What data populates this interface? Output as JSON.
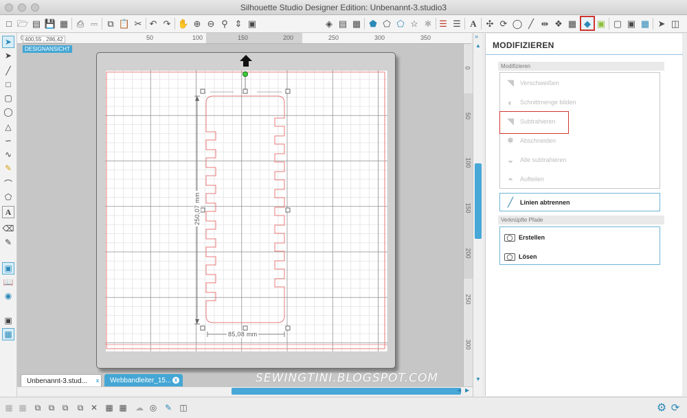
{
  "window": {
    "title": "Silhouette Studio Designer Edition: Unbenannt-3.studio3"
  },
  "canvas": {
    "coords": "400,55 , 286,42",
    "view_tag": "DESIGNANSICHT",
    "ruler_top": [
      "0",
      "50",
      "100",
      "150",
      "200",
      "250",
      "300",
      "350"
    ],
    "ruler_right": [
      "0",
      "50",
      "100",
      "150",
      "200",
      "250",
      "300"
    ],
    "height_label": "250,07 mm",
    "width_label": "85,08 mm",
    "watermark": "SEWINGTINI.BLOGSPOT.COM"
  },
  "tabs": [
    {
      "label": "Unbenannt-3.stud...",
      "active": true
    },
    {
      "label": "Webbandleiter_15...",
      "active": false
    }
  ],
  "panel": {
    "title": "MODIFIZIEREN",
    "section_modify": "Modifizieren",
    "modify_options": [
      {
        "label": "Verschweißen",
        "enabled": false
      },
      {
        "label": "Schnittmenge bilden",
        "enabled": false
      },
      {
        "label": "Subtrahieren",
        "enabled": false
      },
      {
        "label": "Abschneiden",
        "enabled": false
      },
      {
        "label": "Alle subtrahieren",
        "enabled": false
      },
      {
        "label": "Aufteilen",
        "enabled": false
      }
    ],
    "lines_button": "Linien abtrennen",
    "section_paths": "Verknüpfte Pfade",
    "path_options": [
      {
        "label": "Erstellen"
      },
      {
        "label": "Lösen"
      }
    ]
  },
  "colors": {
    "accent": "#44a6d4",
    "highlight": "#d0342c",
    "cut_line": "#e8797a"
  }
}
